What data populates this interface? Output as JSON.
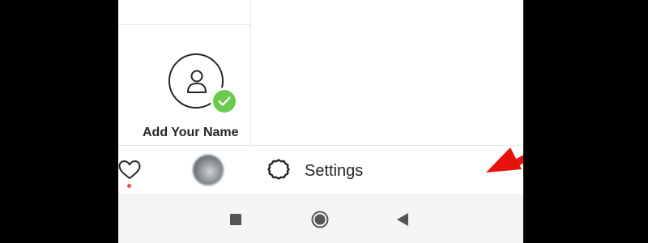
{
  "profile": {
    "add_name_label": "Add Your Name"
  },
  "menu": {
    "settings_label": "Settings"
  },
  "tabbar": {
    "notification_dot_color": "#ed4956"
  },
  "icons": {
    "avatar": "person-outline-icon",
    "badge": "check-icon",
    "settings": "gear-icon",
    "activity": "heart-icon",
    "nav_recent": "square-icon",
    "nav_home": "circle-icon",
    "nav_back": "triangle-back-icon"
  },
  "colors": {
    "accent_green": "#6ccb4f",
    "arrow_red": "#e8120c"
  }
}
